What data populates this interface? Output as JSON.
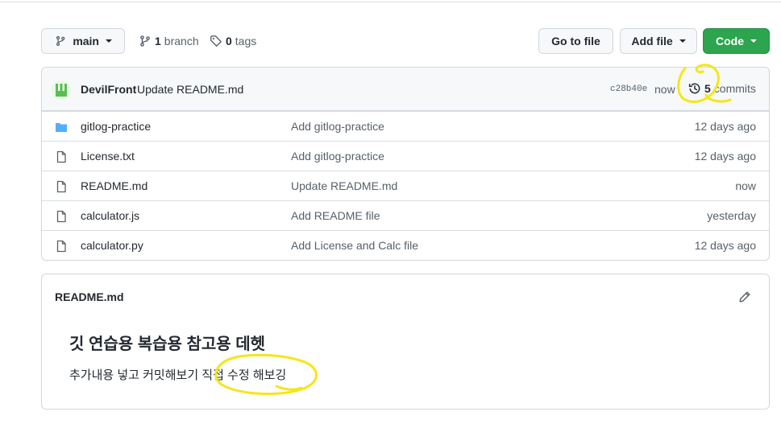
{
  "toolbar": {
    "branch_name": "main",
    "branches_count": "1",
    "branches_label": "branch",
    "tags_count": "0",
    "tags_label": "tags",
    "go_to_file": "Go to file",
    "add_file": "Add file",
    "code": "Code"
  },
  "commit": {
    "author": "DevilFront",
    "message": "Update README.md",
    "sha": "c28b40e",
    "time": "now",
    "commits_count": "5",
    "commits_label": "commits"
  },
  "files": [
    {
      "name": "gitlog-practice",
      "type": "folder",
      "message": "Add gitlog-practice",
      "age": "12 days ago"
    },
    {
      "name": "License.txt",
      "type": "file",
      "message": "Add gitlog-practice",
      "age": "12 days ago"
    },
    {
      "name": "README.md",
      "type": "file",
      "message": "Update README.md",
      "age": "now"
    },
    {
      "name": "calculator.js",
      "type": "file",
      "message": "Add README file",
      "age": "yesterday"
    },
    {
      "name": "calculator.py",
      "type": "file",
      "message": "Add License and Calc file",
      "age": "12 days ago"
    }
  ],
  "readme": {
    "title": "README.md",
    "heading": "깃 연습용 복습용 참고용 데헷",
    "body": "추가내용 넣고 커밋해보기 직접 수정 해보깅"
  },
  "colors": {
    "accent_green": "#2da44e",
    "folder_blue": "#54aeff",
    "annotation_yellow": "#f5e616"
  },
  "icons": {
    "branch": "git-branch-icon",
    "tag": "tag-icon",
    "history": "history-icon",
    "folder": "folder-icon",
    "file": "file-icon",
    "edit": "pencil-icon"
  }
}
